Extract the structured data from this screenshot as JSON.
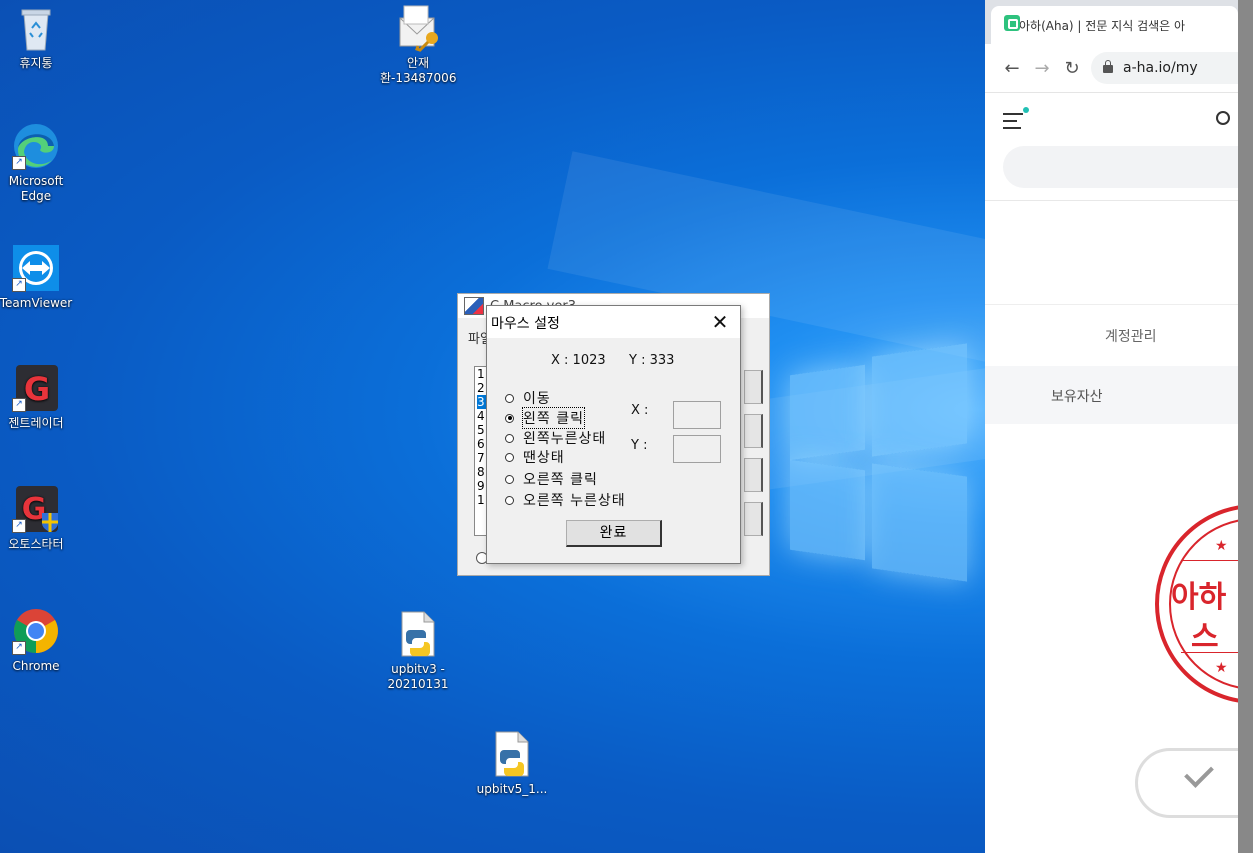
{
  "desktop": {
    "icons": [
      {
        "label": "휴지통"
      },
      {
        "label": "Microsoft Edge"
      },
      {
        "label": "TeamViewer"
      },
      {
        "label": "젠트레이더"
      },
      {
        "label": "오토스타터"
      },
      {
        "label": "Chrome"
      },
      {
        "label": "안재환-13487006"
      },
      {
        "label": "upbitv3 - 20210131"
      },
      {
        "label": "upbitv5_1..."
      }
    ]
  },
  "browser": {
    "tab_title": "아하(Aha) | 전문 지식 검색은 아",
    "url": "a-ha.io/my",
    "account_tab": "계정관리",
    "assets_label": "보유자산",
    "stamp_text_1": "아하",
    "stamp_text_2": "스"
  },
  "back_window": {
    "title": "C Macro ver3",
    "menu": "파일",
    "list_numbers": [
      "1",
      "2",
      "3",
      "4",
      "5",
      "6",
      "7",
      "8",
      "9",
      "1"
    ]
  },
  "dialog": {
    "title": "마우스 설정",
    "close_glyph": "✕",
    "x_readout": "X : 1023",
    "y_readout": "Y : 333",
    "options": [
      {
        "label": "이동",
        "checked": false
      },
      {
        "label": "왼쪽 클릭",
        "checked": true
      },
      {
        "label": "왼쪽누른상태",
        "checked": false
      },
      {
        "label": "땐상태",
        "checked": false
      },
      {
        "label": "오른쪽 클릭",
        "checked": false
      },
      {
        "label": "오른쪽 누른상태",
        "checked": false
      }
    ],
    "x_label": "X :",
    "y_label": "Y :",
    "x_value": "",
    "y_value": "",
    "ok_label": "완료"
  }
}
